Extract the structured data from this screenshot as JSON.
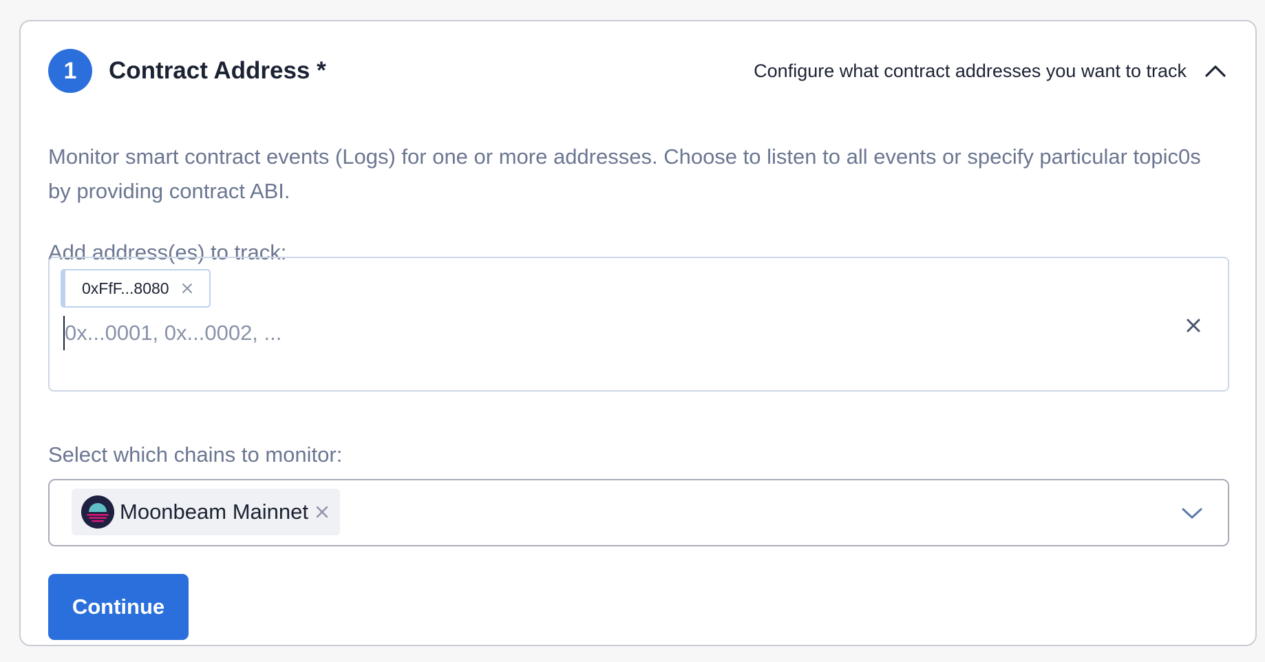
{
  "step": {
    "number": "1",
    "title": "Contract Address *",
    "hint": "Configure what contract addresses you want to track",
    "description": "Monitor smart contract events (Logs) for one or more addresses. Choose to listen to all events or specify particular topic0s by providing contract ABI."
  },
  "addresses": {
    "label": "Add address(es) to track:",
    "tags": [
      {
        "text": "0xFfF...8080"
      }
    ],
    "input": {
      "value": "",
      "placeholder": "0x...0001, 0x...0002, ..."
    }
  },
  "chains": {
    "label": "Select which chains to monitor:",
    "selected": [
      {
        "name": "Moonbeam Mainnet",
        "icon": "moonbeam-logo"
      }
    ]
  },
  "actions": {
    "continue_label": "Continue"
  },
  "colors": {
    "primary": "#2a6fdb",
    "text_dark": "#1b2233",
    "text_muted": "#6b7691",
    "border_light": "#cdd6e6",
    "tag_border": "#bcd2ee",
    "chain_tag_bg": "#f0f1f4",
    "page_bg": "#f7f7f8"
  }
}
